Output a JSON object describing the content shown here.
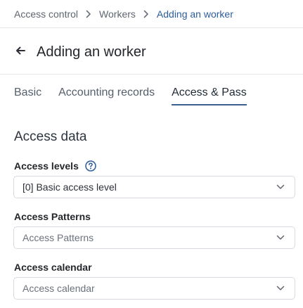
{
  "breadcrumb": {
    "items": [
      "Access control",
      "Workers"
    ],
    "current": "Adding an worker"
  },
  "header": {
    "title": "Adding an worker"
  },
  "tabs": [
    {
      "label": "Basic",
      "active": false
    },
    {
      "label": "Accounting records",
      "active": false
    },
    {
      "label": "Access & Pass",
      "active": true
    }
  ],
  "section": {
    "title": "Access data"
  },
  "fields": {
    "access_levels": {
      "label": "Access levels",
      "value": "[0] Basic access level",
      "placeholder": ""
    },
    "access_patterns": {
      "label": "Access Patterns",
      "value": "",
      "placeholder": "Access Patterns"
    },
    "access_calendar": {
      "label": "Access calendar",
      "value": "",
      "placeholder": "Access calendar"
    }
  },
  "colors": {
    "accent": "#2c5c9e",
    "tab_underline": "#3b5f91",
    "border": "#d6dae0"
  },
  "icons": [
    "chevron-right-icon",
    "arrow-left-icon",
    "help-circle-icon",
    "chevron-down-icon"
  ]
}
